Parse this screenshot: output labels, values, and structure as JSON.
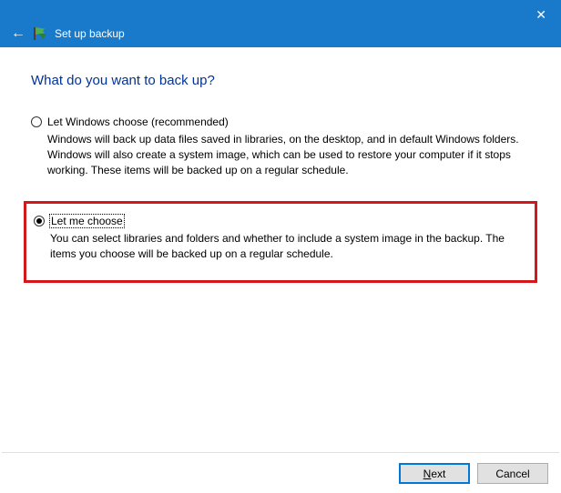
{
  "titlebar": {
    "title": "Set up backup"
  },
  "heading": "What do you want to back up?",
  "options": {
    "win": {
      "label": "Let Windows choose (recommended)",
      "desc": "Windows will back up data files saved in libraries, on the desktop, and in default Windows folders. Windows will also create a system image, which can be used to restore your computer if it stops working. These items will be backed up on a regular schedule.",
      "selected": false
    },
    "me": {
      "label": "Let me choose",
      "desc": "You can select libraries and folders and whether to include a system image in the backup. The items you choose will be backed up on a regular schedule.",
      "selected": true
    }
  },
  "buttons": {
    "next_underline": "N",
    "next_rest": "ext",
    "cancel": "Cancel"
  }
}
